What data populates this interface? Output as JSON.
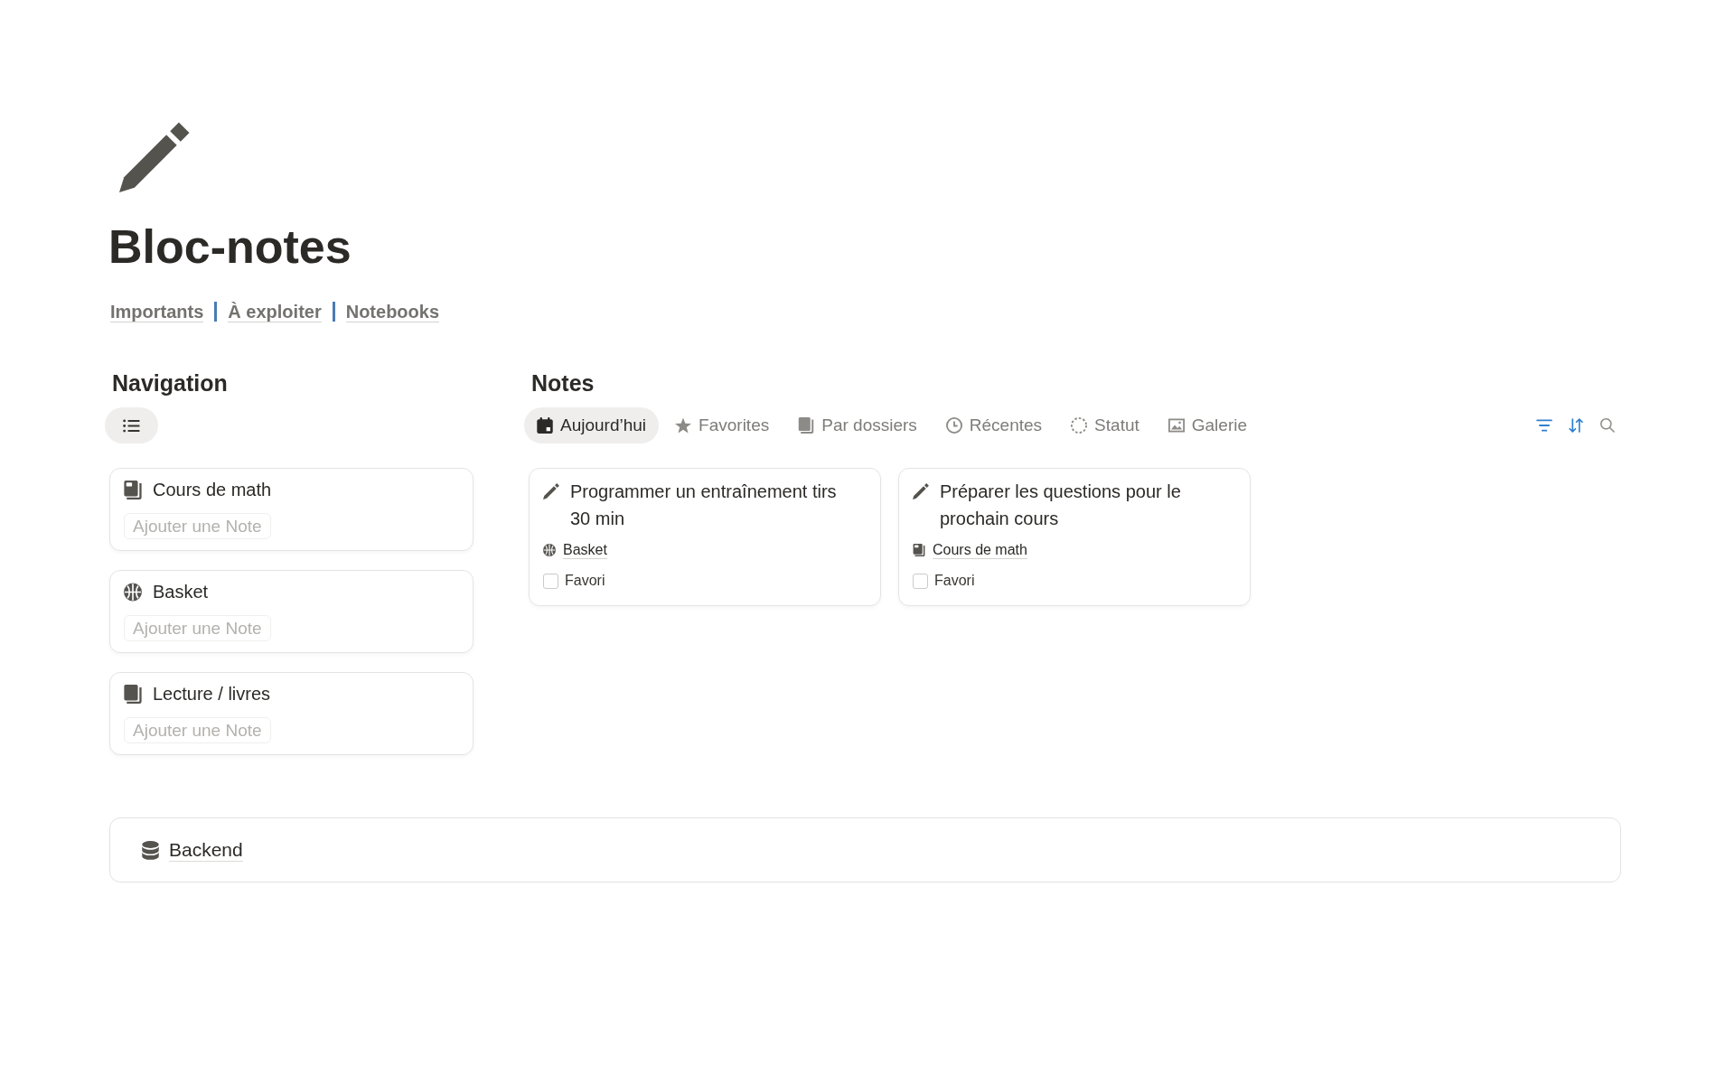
{
  "page": {
    "title": "Bloc-notes"
  },
  "links": [
    {
      "label": "Importants"
    },
    {
      "label": "À exploiter"
    },
    {
      "label": "Notebooks"
    }
  ],
  "navigation": {
    "heading": "Navigation",
    "views": [
      {
        "kind": "list",
        "selected": true
      }
    ],
    "cards": [
      {
        "kind": "notebook",
        "title": "Cours de math",
        "add_button": "Ajouter une Note"
      },
      {
        "kind": "ball",
        "title": "Basket",
        "add_button": "Ajouter une Note"
      },
      {
        "kind": "book",
        "title": "Lecture / livres",
        "add_button": "Ajouter une Note"
      }
    ]
  },
  "notes": {
    "heading": "Notes",
    "views": [
      {
        "kind": "calendar",
        "label": "Aujourd’hui",
        "selected": true
      },
      {
        "kind": "star",
        "label": "Favorites",
        "selected": false
      },
      {
        "kind": "folders",
        "label": "Par dossiers",
        "selected": false
      },
      {
        "kind": "clock",
        "label": "Récentes",
        "selected": false
      },
      {
        "kind": "status",
        "label": "Statut",
        "selected": false
      },
      {
        "kind": "gallery",
        "label": "Galerie",
        "selected": false
      }
    ],
    "toolbar": [
      {
        "kind": "filter",
        "active": true
      },
      {
        "kind": "sort",
        "active": true
      },
      {
        "kind": "search",
        "active": false
      }
    ],
    "cards": [
      {
        "title": "Programmer un entraînement tirs 30 min",
        "category": {
          "kind": "ball",
          "label": "Basket"
        },
        "favorite": {
          "label": "Favori",
          "checked": false
        }
      },
      {
        "title": "Préparer les questions pour le prochain cours",
        "category": {
          "kind": "notebook",
          "label": "Cours de math"
        },
        "favorite": {
          "label": "Favori",
          "checked": false
        }
      }
    ]
  },
  "backend": {
    "label": "Backend"
  }
}
